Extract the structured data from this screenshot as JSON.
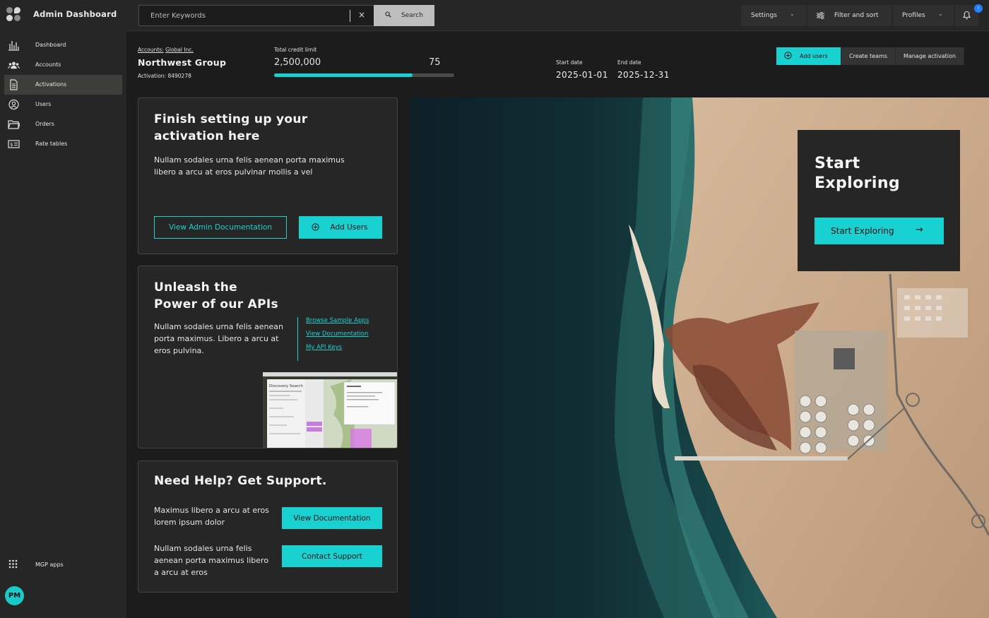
{
  "app": {
    "title": "Admin Dashboard"
  },
  "sidebar": {
    "items": [
      {
        "label": "Dashboard",
        "icon": "bar-chart-icon"
      },
      {
        "label": "Accounts",
        "icon": "group-icon"
      },
      {
        "label": "Activations",
        "icon": "document-icon",
        "active": true
      },
      {
        "label": "Users",
        "icon": "user-circle-icon"
      },
      {
        "label": "Orders",
        "icon": "folder-icon"
      },
      {
        "label": "Rate tables",
        "icon": "price-tag-icon"
      }
    ],
    "apps_label": "MGP apps",
    "avatar_initials": "PM"
  },
  "topbar": {
    "search_placeholder": "Enter Keywords",
    "clear_glyph": "×",
    "search_label": "Search",
    "settings_label": "Settings",
    "filter_label": "Filter and sort",
    "profiles_label": "Profiles",
    "notification_count": "!"
  },
  "header": {
    "breadcrumb_prefix": "Accounts:",
    "breadcrumb_link": "Global Inc.",
    "org_name": "Northwest Group",
    "activation_label": "Activation:",
    "activation_id": "8490278",
    "credit_label": "Total credit limit",
    "credit_value": "2,500,000",
    "credit_percent": "75",
    "credit_progress": 0.77,
    "start_label": "Start date",
    "start_value": "2025-01-01",
    "end_label": "End date",
    "end_value": "2025-12-31",
    "actions": {
      "add_users": "Add users",
      "create_teams": "Create teams",
      "manage_activation": "Manage activation"
    }
  },
  "cards": {
    "setup": {
      "title_line1": "Finish setting up your",
      "title_line2": "activation here",
      "body": "Nullam sodales urna felis aenean porta maximus libero a arcu at eros pulvinar mollis a vel",
      "docs_button": "View Admin Documentation",
      "add_users_button": "Add Users"
    },
    "apis": {
      "title_line1": "Unleash the",
      "title_line2": "Power of our APIs",
      "body": "Nullam sodales urna felis aenean porta maximus. Libero a arcu at eros pulvina.",
      "links": [
        "Browse Sample Apps",
        "View Documentation",
        "My API Keys"
      ],
      "thumbnail_title": "Discovery Search"
    },
    "support": {
      "title": "Need Help? Get Support.",
      "text1": "Maximus libero a arcu at eros lorem ipsum dolor",
      "button1": "View Documentation",
      "text2": "Nullam sodales urna felis aenean porta maximus libero a arcu at eros",
      "button2": "Contact Support"
    }
  },
  "explore": {
    "title_line1": "Start",
    "title_line2": "Exploring",
    "button": "Start Exploring",
    "arrow": "→"
  },
  "colors": {
    "accent": "#1ad1d1",
    "sidebar": "#262626",
    "background": "#1c1c1c",
    "notification": "#1e7fff"
  }
}
